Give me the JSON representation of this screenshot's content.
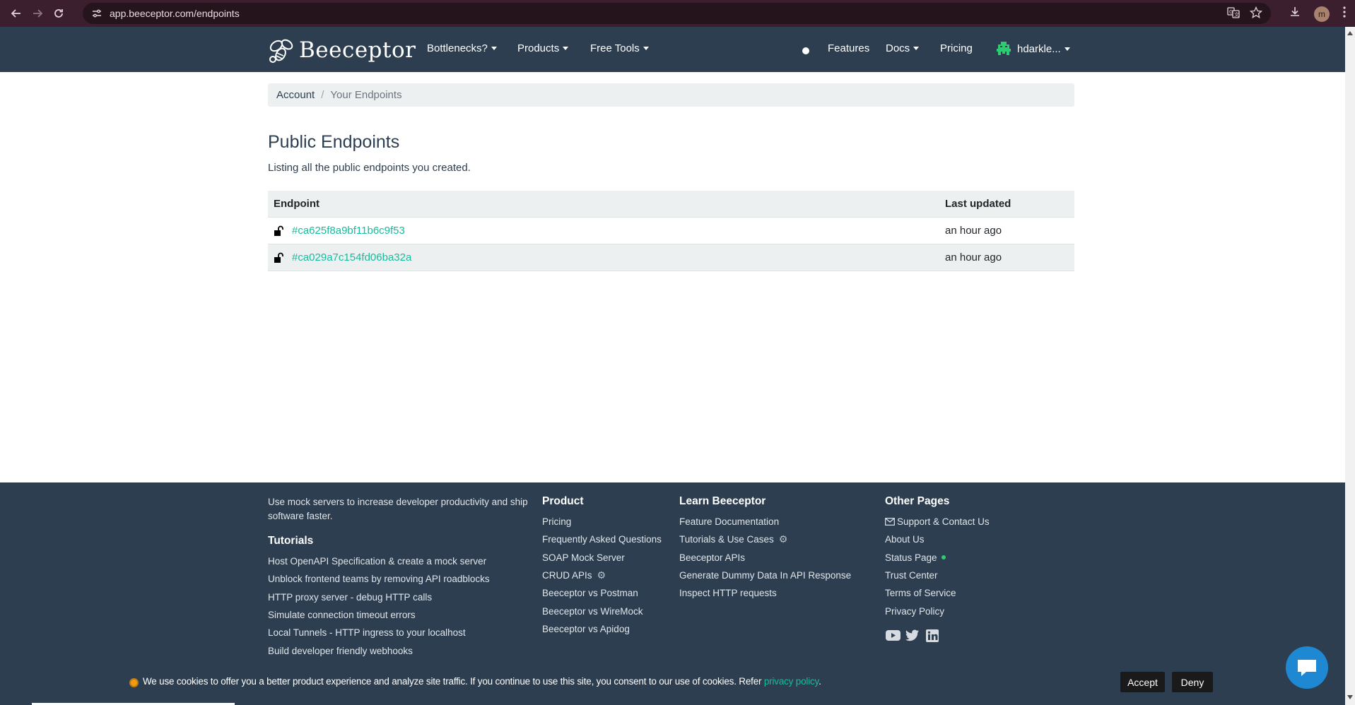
{
  "browser": {
    "url": "app.beeceptor.com/endpoints",
    "profile_initial": "m"
  },
  "navbar": {
    "brand": "Beeceptor",
    "items": [
      {
        "label": "Bottlenecks?"
      },
      {
        "label": "Products"
      },
      {
        "label": "Free Tools"
      },
      {
        "label": "Features"
      },
      {
        "label": "Docs"
      },
      {
        "label": "Pricing"
      }
    ],
    "user": "hdarkle..."
  },
  "breadcrumb": {
    "account": "Account",
    "separator": "/",
    "current": "Your Endpoints"
  },
  "main": {
    "title": "Public Endpoints",
    "subtitle": "Listing all the public endpoints you created."
  },
  "table": {
    "columns": [
      "Endpoint",
      "Last updated"
    ],
    "rows": [
      {
        "endpoint": "#ca625f8a9bf11b6c9f53",
        "updated": "an hour ago"
      },
      {
        "endpoint": "#ca029a7c154fd06ba32a",
        "updated": "an hour ago"
      }
    ]
  },
  "footer": {
    "tagline": "Use mock servers to increase developer productivity and ship software faster.",
    "tutorials": {
      "heading": "Tutorials",
      "links": [
        "Host OpenAPI Specification & create a mock server",
        "Unblock frontend teams by removing API roadblocks",
        "HTTP proxy server - debug HTTP calls",
        "Simulate connection timeout errors",
        "Local Tunnels - HTTP ingress to your localhost",
        "Build developer friendly webhooks"
      ]
    },
    "product": {
      "heading": "Product",
      "links": [
        "Pricing",
        "Frequently Asked Questions",
        "SOAP Mock Server",
        "CRUD APIs",
        "Beeceptor vs Postman",
        "Beeceptor vs WireMock",
        "Beeceptor vs Apidog"
      ]
    },
    "learn": {
      "heading": "Learn Beeceptor",
      "links": [
        "Feature Documentation",
        "Tutorials & Use Cases",
        "Beeceptor APIs",
        "Generate Dummy Data In API Response",
        "Inspect HTTP requests"
      ]
    },
    "other": {
      "heading": "Other Pages",
      "links": [
        "Support & Contact Us",
        "About Us",
        "Status Page",
        "Trust Center",
        "Terms of Service",
        "Privacy Policy"
      ]
    },
    "social_icons": [
      "youtube-icon",
      "twitter-icon",
      "linkedin-icon"
    ]
  },
  "cookie": {
    "text": "We use cookies to offer you a better product experience and analyze site traffic. If you continue to use this site, you consent to our use of cookies. Refer ",
    "link": "privacy policy",
    "end": ".",
    "accept": "Accept",
    "deny": "Deny"
  },
  "colors": {
    "navbar": "#2c3e50",
    "accent": "#18bc9c",
    "breadcrumb_bg": "#ecf0f1",
    "chat": "#1e88d2"
  }
}
